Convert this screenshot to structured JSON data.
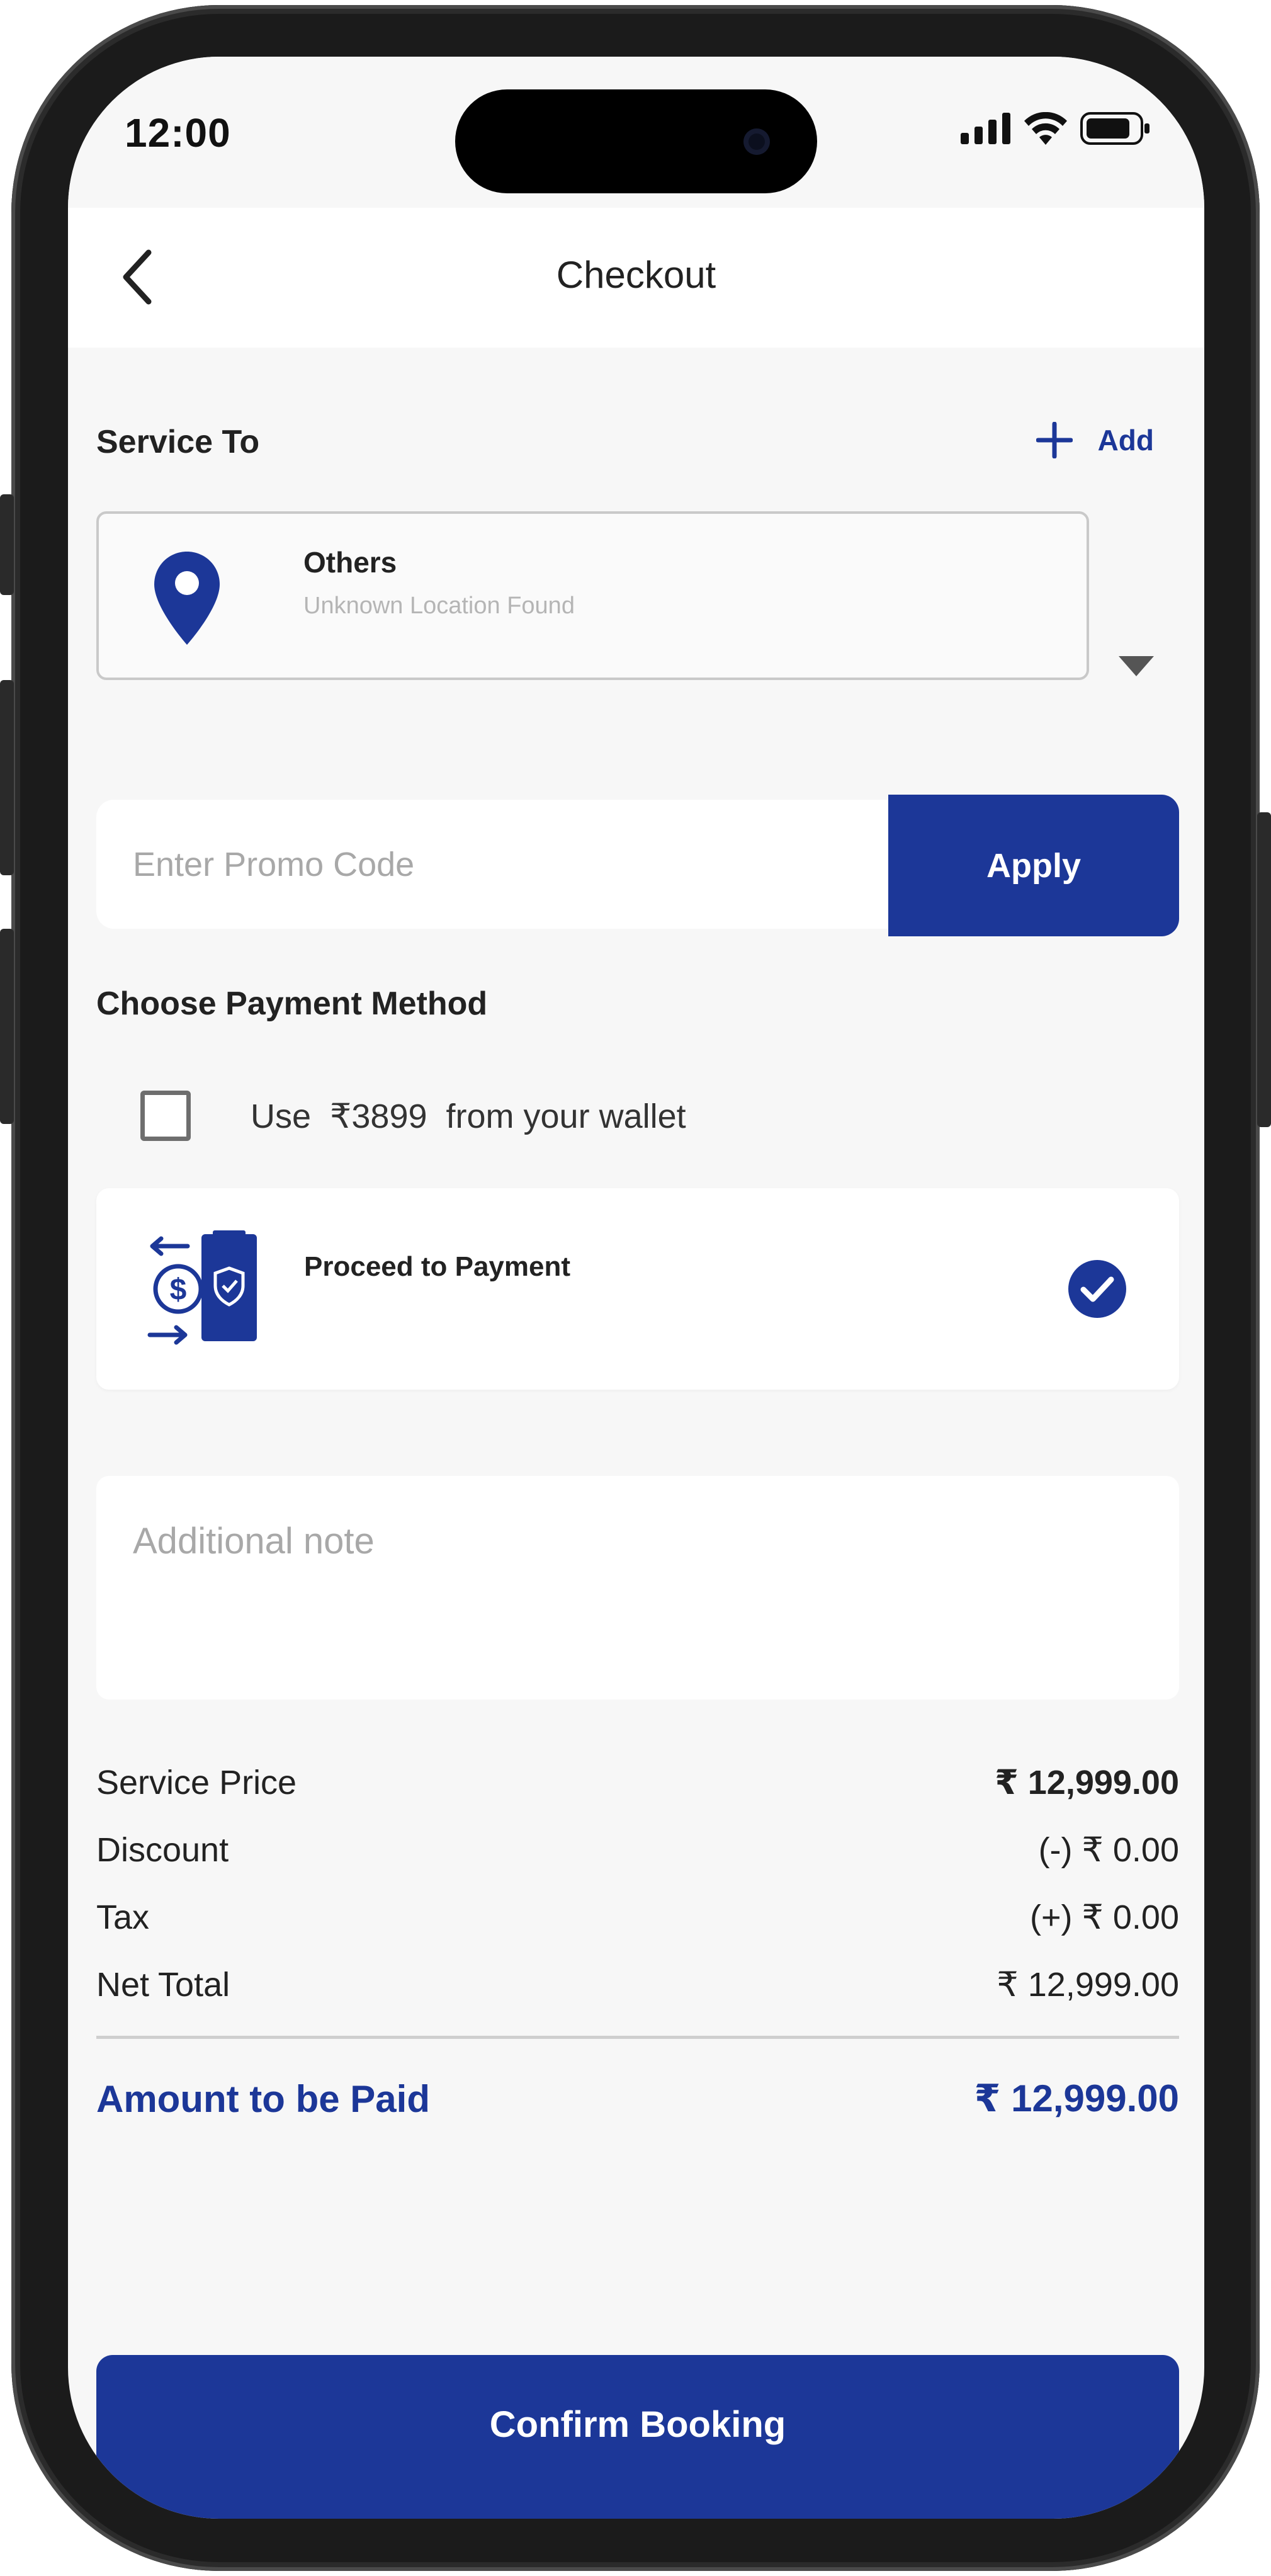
{
  "status_bar": {
    "time": "12:00"
  },
  "header": {
    "title": "Checkout"
  },
  "service_to": {
    "label": "Service To",
    "add_label": "Add",
    "address": {
      "name": "Others",
      "subtitle": "Unknown Location Found"
    }
  },
  "promo": {
    "placeholder": "Enter Promo Code",
    "apply_label": "Apply"
  },
  "payment": {
    "section_label": "Choose Payment Method",
    "wallet_text": "Use  ₹3899  from your wallet",
    "wallet_checked": false,
    "option_label": "Proceed to Payment",
    "option_selected": true
  },
  "note": {
    "placeholder": "Additional note"
  },
  "summary": {
    "rows": [
      {
        "label": "Service Price",
        "value": "₹ 12,999.00"
      },
      {
        "label": "Discount",
        "value": "(-) ₹ 0.00"
      },
      {
        "label": "Tax",
        "value": "(+) ₹ 0.00"
      },
      {
        "label": "Net Total",
        "value": "₹ 12,999.00"
      }
    ],
    "total_label": "Amount to be Paid",
    "total_value": "₹ 12,999.00"
  },
  "confirm": {
    "label": "Confirm Booking"
  },
  "colors": {
    "accent": "#1c3798",
    "background": "#f7f7f7"
  }
}
